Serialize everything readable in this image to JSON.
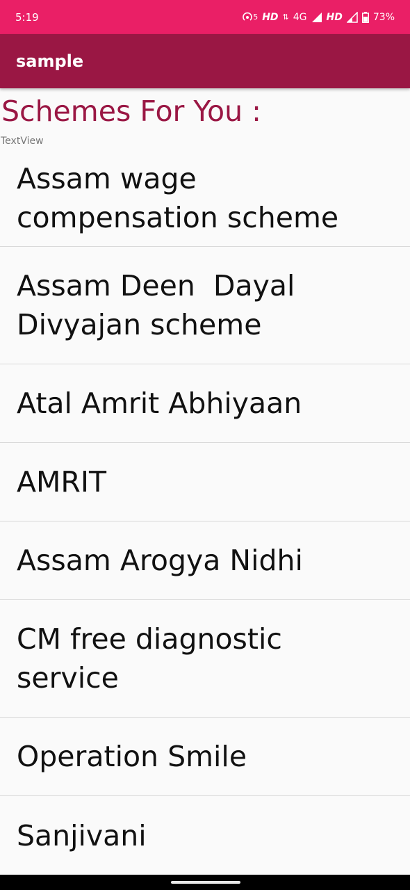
{
  "status_bar": {
    "time": "5:19",
    "hotspot": "5",
    "hd1": "HD",
    "network": "4G",
    "hd2": "HD",
    "battery": "73%"
  },
  "app_bar": {
    "title": "sample"
  },
  "heading": "Schemes For You :",
  "textview_label": "TextView",
  "schemes": [
    "Assam wage compensation scheme",
    "Assam Deen  Dayal Divyajan scheme",
    "Atal Amrit Abhiyaan",
    "AMRIT",
    "Assam Arogya Nidhi",
    "CM free diagnostic service",
    "Operation Smile",
    "Sanjivani"
  ],
  "colors": {
    "status_bar": "#ea1f66",
    "app_bar": "#9a1744",
    "heading": "#9a1744"
  }
}
